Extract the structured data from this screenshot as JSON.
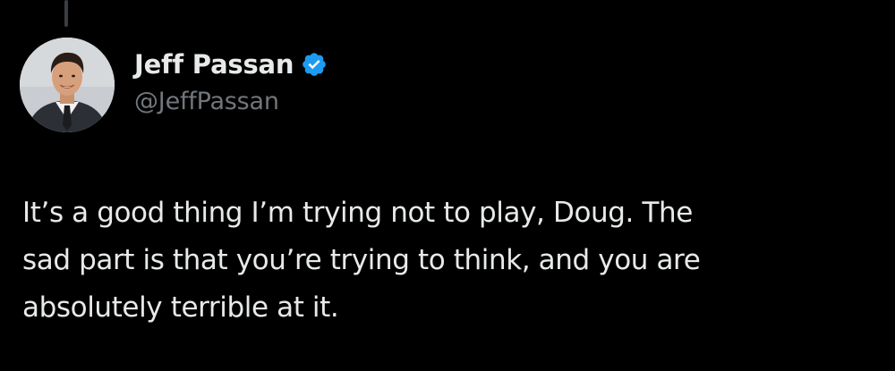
{
  "tweet": {
    "author": {
      "display_name": "Jeff Passan",
      "handle": "@JeffPassan",
      "verified": true,
      "avatar_icon": "profile-photo-avatar",
      "verified_icon": "verified-badge-icon"
    },
    "text": "It’s a good thing I’m trying not to play, Doug. The\nsad part is that you’re trying to think, and you are\nabsolutely terrible at it."
  },
  "theme": {
    "background": "#000000",
    "text_primary": "#e7e9ea",
    "text_secondary": "#71767b",
    "verified_blue": "#1d9bf0",
    "thread_line": "#3a3d41"
  }
}
